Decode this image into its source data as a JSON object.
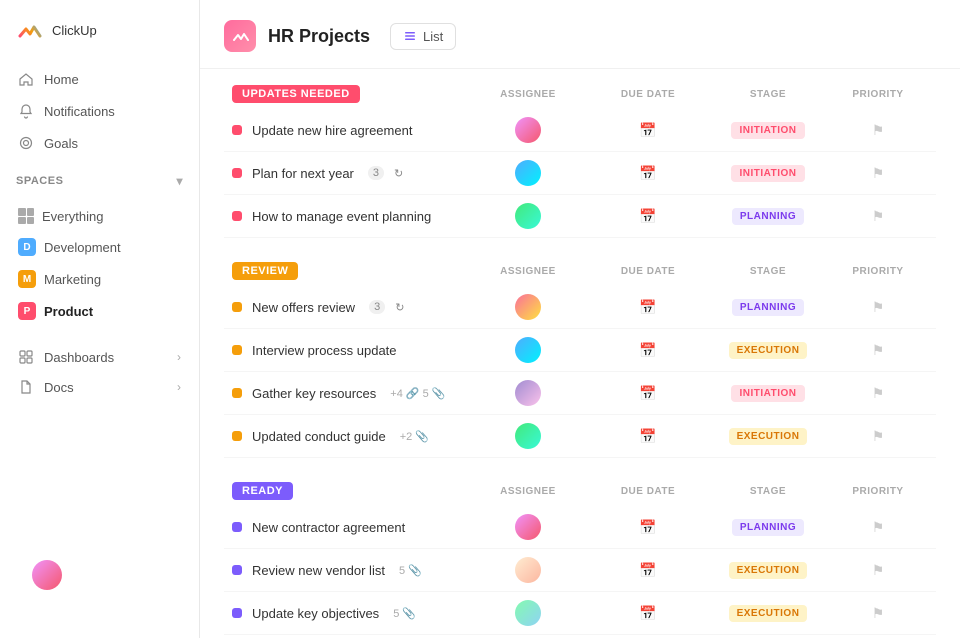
{
  "sidebar": {
    "logo_text": "ClickUp",
    "nav_items": [
      {
        "label": "Home",
        "icon": "home"
      },
      {
        "label": "Notifications",
        "icon": "bell"
      },
      {
        "label": "Goals",
        "icon": "target"
      }
    ],
    "spaces_label": "Spaces",
    "spaces": [
      {
        "label": "Everything",
        "icon": "grid",
        "color": null
      },
      {
        "label": "Development",
        "icon": "letter",
        "letter": "D",
        "color": "#4facfe"
      },
      {
        "label": "Marketing",
        "icon": "letter",
        "letter": "M",
        "color": "#f59e0b"
      },
      {
        "label": "Product",
        "icon": "letter",
        "letter": "P",
        "color": "#ff4d6d",
        "active": true
      }
    ],
    "bottom_nav": [
      {
        "label": "Dashboards",
        "has_arrow": true
      },
      {
        "label": "Docs",
        "has_arrow": true
      }
    ]
  },
  "header": {
    "project_title": "HR Projects",
    "view_label": "List"
  },
  "sections": [
    {
      "id": "updates",
      "label": "UPDATES NEEDED",
      "label_class": "label-updates",
      "tasks": [
        {
          "name": "Update new hire agreement",
          "dot": "dot-red",
          "avatar": "av1",
          "stage": "INITIATION",
          "stage_class": "stage-initiation"
        },
        {
          "name": "Plan for next year",
          "dot": "dot-red",
          "avatar": "av2",
          "stage": "INITIATION",
          "stage_class": "stage-initiation",
          "badge": "3",
          "refresh": true
        },
        {
          "name": "How to manage event planning",
          "dot": "dot-red",
          "avatar": "av3",
          "stage": "PLANNING",
          "stage_class": "stage-planning"
        }
      ]
    },
    {
      "id": "review",
      "label": "REVIEW",
      "label_class": "label-review",
      "tasks": [
        {
          "name": "New offers review",
          "dot": "dot-yellow",
          "avatar": "av4",
          "stage": "PLANNING",
          "stage_class": "stage-planning",
          "badge": "3",
          "refresh": true
        },
        {
          "name": "Interview process update",
          "dot": "dot-yellow",
          "avatar": "av2",
          "stage": "EXECUTION",
          "stage_class": "stage-execution"
        },
        {
          "name": "Gather key resources",
          "dot": "dot-yellow",
          "avatar": "av5",
          "stage": "INITIATION",
          "stage_class": "stage-initiation",
          "extra_badge": "+4",
          "attach": "5"
        },
        {
          "name": "Updated conduct guide",
          "dot": "dot-yellow",
          "avatar": "av3",
          "stage": "EXECUTION",
          "stage_class": "stage-execution",
          "extra_badge": "+2"
        }
      ]
    },
    {
      "id": "ready",
      "label": "READY",
      "label_class": "label-ready",
      "tasks": [
        {
          "name": "New contractor agreement",
          "dot": "dot-purple",
          "avatar": "av1",
          "stage": "PLANNING",
          "stage_class": "stage-planning"
        },
        {
          "name": "Review new vendor list",
          "dot": "dot-purple",
          "avatar": "av6",
          "stage": "EXECUTION",
          "stage_class": "stage-execution",
          "attach": "5"
        },
        {
          "name": "Update key objectives",
          "dot": "dot-purple",
          "avatar": "av7",
          "stage": "EXECUTION",
          "stage_class": "stage-execution",
          "attach": "5"
        }
      ]
    }
  ],
  "columns": [
    "ASSIGNEE",
    "DUE DATE",
    "STAGE",
    "PRIORITY"
  ]
}
